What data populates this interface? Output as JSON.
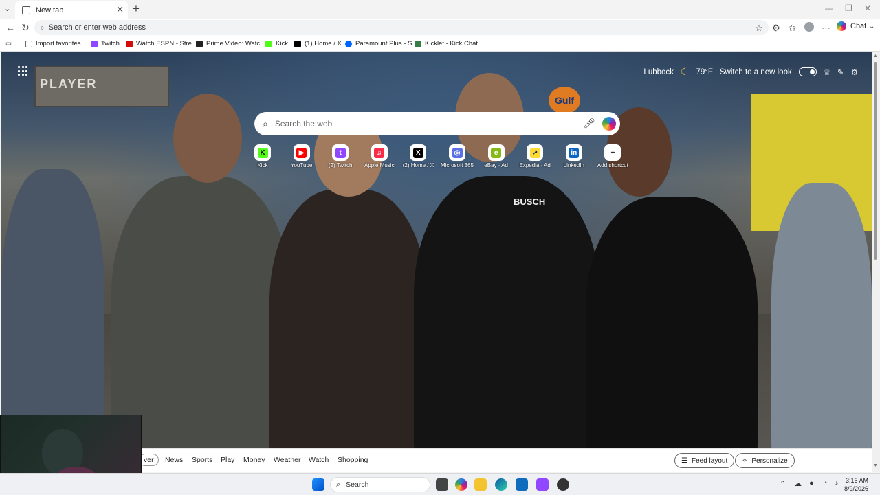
{
  "browser": {
    "tab_title": "New tab",
    "address_placeholder": "Search or enter web address",
    "chat_label": "Chat"
  },
  "favorites": [
    {
      "label": "Import favorites",
      "color": "#666666"
    },
    {
      "label": "Twitch",
      "color": "#9146ff"
    },
    {
      "label": "Watch ESPN - Stre...",
      "color": "#d50a0a"
    },
    {
      "label": "Prime Video: Watc...",
      "color": "#222222"
    },
    {
      "label": "Kick",
      "color": "#53fc18"
    },
    {
      "label": "(1) Home / X",
      "color": "#000000"
    },
    {
      "label": "Paramount Plus - S...",
      "color": "#0064ff"
    },
    {
      "label": "Kicklet - Kick Chat...",
      "color": "#3a7d44"
    }
  ],
  "newtab": {
    "location": "Lubbock",
    "temperature": "79°F",
    "switch_label": "Switch to a new look",
    "search_placeholder": "Search the web"
  },
  "shortcuts": [
    {
      "label": "Kick",
      "glyph": "K",
      "color": "#53fc18",
      "text_color": "#000000"
    },
    {
      "label": "YouTube",
      "glyph": "▶",
      "color": "#ff0000",
      "text_color": "#ffffff"
    },
    {
      "label": "(2) Twitch",
      "glyph": "t",
      "color": "#9146ff",
      "text_color": "#ffffff"
    },
    {
      "label": "Apple Music",
      "glyph": "♫",
      "color": "#fa2d48",
      "text_color": "#ffffff"
    },
    {
      "label": "(2) Home / X",
      "glyph": "X",
      "color": "#000000",
      "text_color": "#ffffff"
    },
    {
      "label": "Microsoft 365",
      "glyph": "◎",
      "color": "#5b6fe6",
      "text_color": "#ffffff"
    },
    {
      "label": "eBay · Ad",
      "glyph": "e",
      "color": "#86b817",
      "text_color": "#ffffff"
    },
    {
      "label": "Expedia · Ad",
      "glyph": "↗",
      "color": "#fddb32",
      "text_color": "#1f2b6c"
    },
    {
      "label": "LinkedIn",
      "glyph": "in",
      "color": "#0a66c2",
      "text_color": "#ffffff"
    },
    {
      "label": "Add shortcut",
      "glyph": "+",
      "color": "#ffffff",
      "text_color": "#333333"
    }
  ],
  "feed": {
    "tabs": [
      "ver",
      "News",
      "Sports",
      "Play",
      "Money",
      "Weather",
      "Watch",
      "Shopping"
    ],
    "feed_layout_label": "Feed layout",
    "personalize_label": "Personalize"
  },
  "taskbar": {
    "search_label": "Search",
    "time": "3:16 AM",
    "date": "8/9/2026"
  },
  "photo": {
    "billboard_text": "PLAYER",
    "gulf_sign": "Gulf",
    "shirt_text": "BUSCH"
  }
}
